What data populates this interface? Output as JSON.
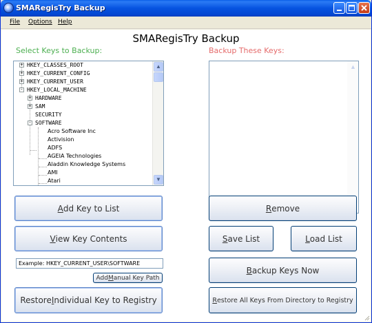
{
  "window": {
    "title": "SMARegisTry Backup",
    "colors": {
      "titlebar": "#0653e0",
      "left_label": "#4caf50",
      "right_label": "#e56b6b"
    }
  },
  "menu": {
    "file": "File",
    "options": "Options",
    "help": "Help"
  },
  "header": {
    "app_title": "SMARegisTry Backup"
  },
  "left_pane": {
    "label": "Select Keys to Backup:",
    "tree": [
      {
        "label": "HKEY_CLASSES_ROOT",
        "expander": "+"
      },
      {
        "label": "HKEY_CURRENT_CONFIG",
        "expander": "+"
      },
      {
        "label": "HKEY_CURRENT_USER",
        "expander": "+"
      },
      {
        "label": "HKEY_LOCAL_MACHINE",
        "expander": "-"
      },
      {
        "label": "HARDWARE",
        "expander": "+"
      },
      {
        "label": "SAM",
        "expander": "+"
      },
      {
        "label": "SECURITY",
        "expander": ""
      },
      {
        "label": "SOFTWARE",
        "expander": "-"
      },
      {
        "label": "Acro Software Inc",
        "expander": ""
      },
      {
        "label": "Activision",
        "expander": ""
      },
      {
        "label": "ADFS",
        "expander": ""
      },
      {
        "label": "AGEIA Technologies",
        "expander": ""
      },
      {
        "label": "Aladdin Knowledge Systems",
        "expander": ""
      },
      {
        "label": "AMI",
        "expander": ""
      },
      {
        "label": "Atari",
        "expander": ""
      }
    ],
    "scroll": {
      "up": "▲",
      "down": "▼"
    }
  },
  "right_pane": {
    "label": "Backup These Keys:",
    "scroll": {
      "up": "▲",
      "down": "▼",
      "left": "◀",
      "right": "▶"
    }
  },
  "buttons": {
    "add_key": {
      "pre": "",
      "accel": "A",
      "post": "dd Key to List"
    },
    "view_key": {
      "pre": "",
      "accel": "V",
      "post": "iew Key Contents"
    },
    "remove": {
      "pre": "",
      "accel": "R",
      "post": "emove"
    },
    "save_list": {
      "pre": "",
      "accel": "S",
      "post": "ave List"
    },
    "load_list": {
      "pre": "",
      "accel": "L",
      "post": "oad List"
    },
    "backup_now": {
      "pre": "",
      "accel": "B",
      "post": "ackup Keys Now"
    },
    "add_manual": {
      "pre": "Add ",
      "accel": "M",
      "post": "anual Key Path"
    },
    "restore_individual": {
      "pre": "Restore ",
      "accel": "I",
      "post": "ndividual Key to Registry"
    },
    "restore_all": {
      "pre": "",
      "accel": "R",
      "post": "estore All Keys From Directory to Registry"
    }
  },
  "manual_path": {
    "value": "Example:  HKEY_CURRENT_USER\\SOFTWARE"
  }
}
